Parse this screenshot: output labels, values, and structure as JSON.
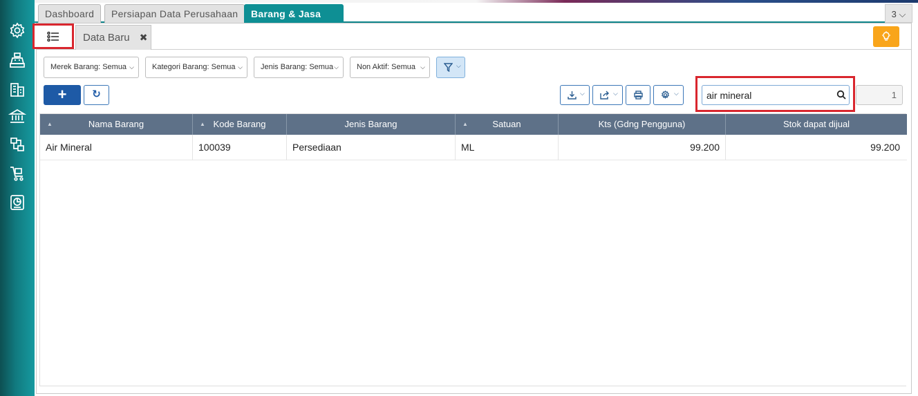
{
  "tabs": {
    "dashboard": "Dashboard",
    "persiapan": "Persiapan Data Perusahaan",
    "barang_jasa": "Barang & Jasa",
    "close_symbol": "✖",
    "open_count": "3 ⌵"
  },
  "subtabs": {
    "data_baru": "Data Baru",
    "close_symbol": "✖"
  },
  "filters": {
    "merek": "Merek Barang: Semua",
    "kategori": "Kategori Barang: Semua",
    "jenis": "Jenis Barang: Semua",
    "nonaktif": "Non Aktif: Semua"
  },
  "search": {
    "value": "air mineral"
  },
  "pagination": {
    "page": "1"
  },
  "table": {
    "columns": [
      "Nama Barang",
      "Kode Barang",
      "Jenis Barang",
      "Satuan",
      "Kts (Gdng Pengguna)",
      "Stok dapat dijual"
    ],
    "rows": [
      [
        "Air Mineral",
        "100039",
        "Persediaan",
        "ML",
        "99.200",
        "99.200"
      ]
    ]
  },
  "icons": {
    "sidebar": [
      "settings-icon",
      "cash-register-icon",
      "building-icon",
      "bank-icon",
      "production-icon",
      "cart-icon",
      "report-icon"
    ],
    "toolbar": [
      "list-icon",
      "lightbulb-icon",
      "filter-icon",
      "plus-icon",
      "refresh-icon",
      "download-icon",
      "share-icon",
      "print-icon",
      "gear-icon",
      "search-icon"
    ]
  },
  "colors": {
    "teal": "#0e8f94",
    "primary_blue": "#1e5aa6",
    "header_slate": "#5e7188",
    "highlight_red": "#d9262e",
    "bulb_orange": "#f9a51a"
  }
}
